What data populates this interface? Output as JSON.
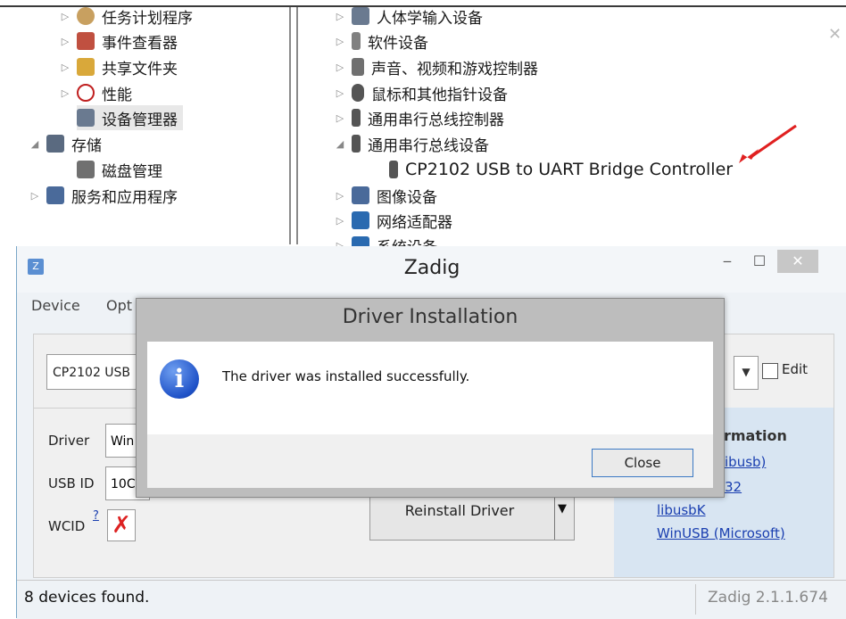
{
  "device_manager": {
    "left_items": [
      {
        "label": "任务计划程序",
        "expander": "▷",
        "icon_color": "#c8a060"
      },
      {
        "label": "事件查看器",
        "expander": "▷",
        "icon_color": "#c05040"
      },
      {
        "label": "共享文件夹",
        "expander": "▷",
        "icon_color": "#d9a83a"
      },
      {
        "label": "性能",
        "expander": "▷",
        "icon_color": "#c02020"
      },
      {
        "label": "设备管理器",
        "expander": "",
        "icon_color": "#6a7a90"
      },
      {
        "label": "存储",
        "expander": "◢",
        "icon_color": "#5a6a80"
      },
      {
        "label": "磁盘管理",
        "expander": "",
        "icon_color": "#707070"
      },
      {
        "label": "服务和应用程序",
        "expander": "▷",
        "icon_color": "#4a6a9a"
      }
    ],
    "right_items": [
      {
        "label": "人体学输入设备",
        "expander": "▷",
        "icon_color": "#6a7a90"
      },
      {
        "label": "软件设备",
        "expander": "▷",
        "icon_color": "#808080"
      },
      {
        "label": "声音、视频和游戏控制器",
        "expander": "▷",
        "icon_color": "#707070"
      },
      {
        "label": "鼠标和其他指针设备",
        "expander": "▷",
        "icon_color": "#555555"
      },
      {
        "label": "通用串行总线控制器",
        "expander": "▷",
        "icon_color": "#555555"
      },
      {
        "label": "通用串行总线设备",
        "expander": "◢",
        "icon_color": "#555555"
      },
      {
        "label": "CP2102 USB to UART Bridge Controller",
        "expander": "",
        "icon_color": "#555555"
      },
      {
        "label": "图像设备",
        "expander": "▷",
        "icon_color": "#4a6a9a"
      },
      {
        "label": "网络适配器",
        "expander": "▷",
        "icon_color": "#2a6ab0"
      },
      {
        "label": "系统设备",
        "expander": "▷",
        "icon_color": "#2a6ab0"
      }
    ]
  },
  "zadig": {
    "title": "Zadig",
    "app_icon": "Z",
    "minimize": "‒",
    "maximize": "☐",
    "close": "✕",
    "menu": {
      "device": "Device",
      "options": "Opt"
    },
    "device_combo": "CP2102 USB",
    "edit_label": "Edit",
    "driver_label": "Driver",
    "driver_value": "Win",
    "usbid_label": "USB ID",
    "usbid_value": "10C",
    "wcid_label": "WCID",
    "wcid_help": "?",
    "wcid_status": "✗",
    "reinstall_label": "Reinstall Driver",
    "info_header": "ormation",
    "links": [
      "ibusb)",
      "32",
      "libusbK",
      "WinUSB (Microsoft)"
    ],
    "status_left": "8 devices found.",
    "status_right": "Zadig 2.1.1.674"
  },
  "dialog": {
    "title": "Driver Installation",
    "icon": "i",
    "message": "The driver was installed successfully.",
    "close_label": "Close"
  },
  "colors": {
    "arrow": "#e02020",
    "link": "#1a3fb0",
    "info_panel": "#d8e5f2"
  }
}
